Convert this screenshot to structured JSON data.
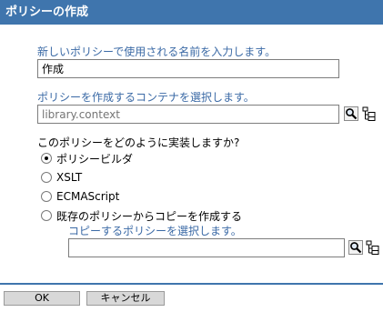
{
  "title": "ポリシーの作成",
  "name_section": {
    "label": "新しいポリシーで使用される名前を入力します。",
    "value": "作成"
  },
  "container_section": {
    "label": "ポリシーを作成するコンテナを選択します。",
    "placeholder": "library.context"
  },
  "implementation": {
    "question": "このポリシーをどのように実装しますか?",
    "options": [
      {
        "label": "ポリシービルダ",
        "checked": true
      },
      {
        "label": "XSLT",
        "checked": false
      },
      {
        "label": "ECMAScript",
        "checked": false
      },
      {
        "label": "既存のポリシーからコピーを作成する",
        "checked": false
      }
    ]
  },
  "copy_section": {
    "label": "コピーするポリシーを選択します。",
    "value": ""
  },
  "buttons": {
    "ok": "OK",
    "cancel": "キャンセル"
  },
  "icons": [
    "browse-icon",
    "tree-icon"
  ]
}
